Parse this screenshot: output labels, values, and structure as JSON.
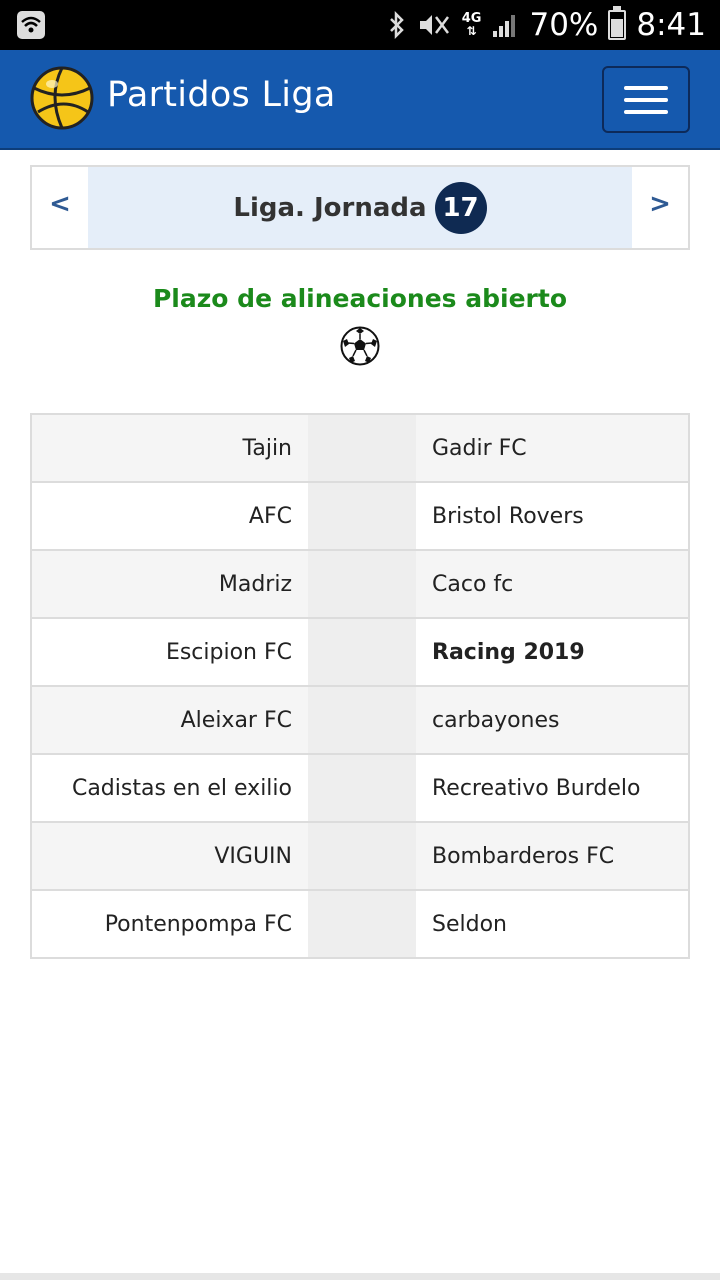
{
  "status_bar": {
    "battery": "70%",
    "time": "8:41",
    "network": "4G",
    "icons": [
      "wifi-calling-icon",
      "bluetooth-icon",
      "mute-vibrate-icon",
      "signal-icon",
      "battery-icon"
    ]
  },
  "header": {
    "title": "Partidos Liga",
    "logo_icon": "volleyball-logo-icon",
    "menu_icon": "hamburger-menu-icon",
    "color": "#1559ae"
  },
  "round": {
    "prev": "<",
    "label": "Liga. Jornada",
    "number": "17",
    "next": ">"
  },
  "status_message": "Plazo de alineaciones abierto",
  "status_color": "#1b8a1b",
  "matches": [
    {
      "home": "Tajin",
      "away": "Gadir FC",
      "winner": ""
    },
    {
      "home": "AFC",
      "away": "Bristol Rovers",
      "winner": ""
    },
    {
      "home": "Madriz",
      "away": "Caco fc",
      "winner": ""
    },
    {
      "home": "Escipion FC",
      "away": "Racing 2019",
      "winner": "away"
    },
    {
      "home": "Aleixar FC",
      "away": "carbayones",
      "winner": ""
    },
    {
      "home": "Cadistas en el exilio",
      "away": "Recreativo Burdelo",
      "winner": ""
    },
    {
      "home": "VIGUIN",
      "away": "Bombarderos FC",
      "winner": ""
    },
    {
      "home": "Pontenpompa FC",
      "away": "Seldon",
      "winner": ""
    }
  ]
}
